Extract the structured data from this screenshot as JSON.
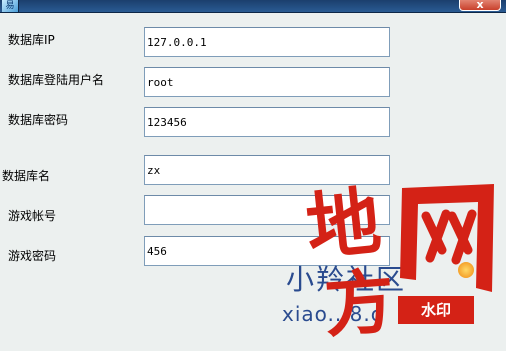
{
  "window": {
    "icon_glyph": "易",
    "close_label": "x"
  },
  "form": {
    "db_ip": {
      "label": "数据库IP",
      "value": "127.0.0.1"
    },
    "db_user": {
      "label": "数据库登陆用户名",
      "value": "root"
    },
    "db_password": {
      "label": "数据库密码",
      "value": "123456"
    },
    "db_name": {
      "label": "数据库名",
      "value": "zx"
    },
    "game_account": {
      "label": "游戏帐号",
      "value": ""
    },
    "game_password": {
      "label": "游戏密码",
      "value": "456"
    }
  },
  "watermark": {
    "char_di": "地",
    "char_fang": "方",
    "char_wang": "网",
    "site_text": "小羚社区",
    "url_text": "xiao...8.c",
    "stamp_text": "水印",
    "colors": {
      "red": "#d42216",
      "blue": "#2a4b8f"
    }
  }
}
